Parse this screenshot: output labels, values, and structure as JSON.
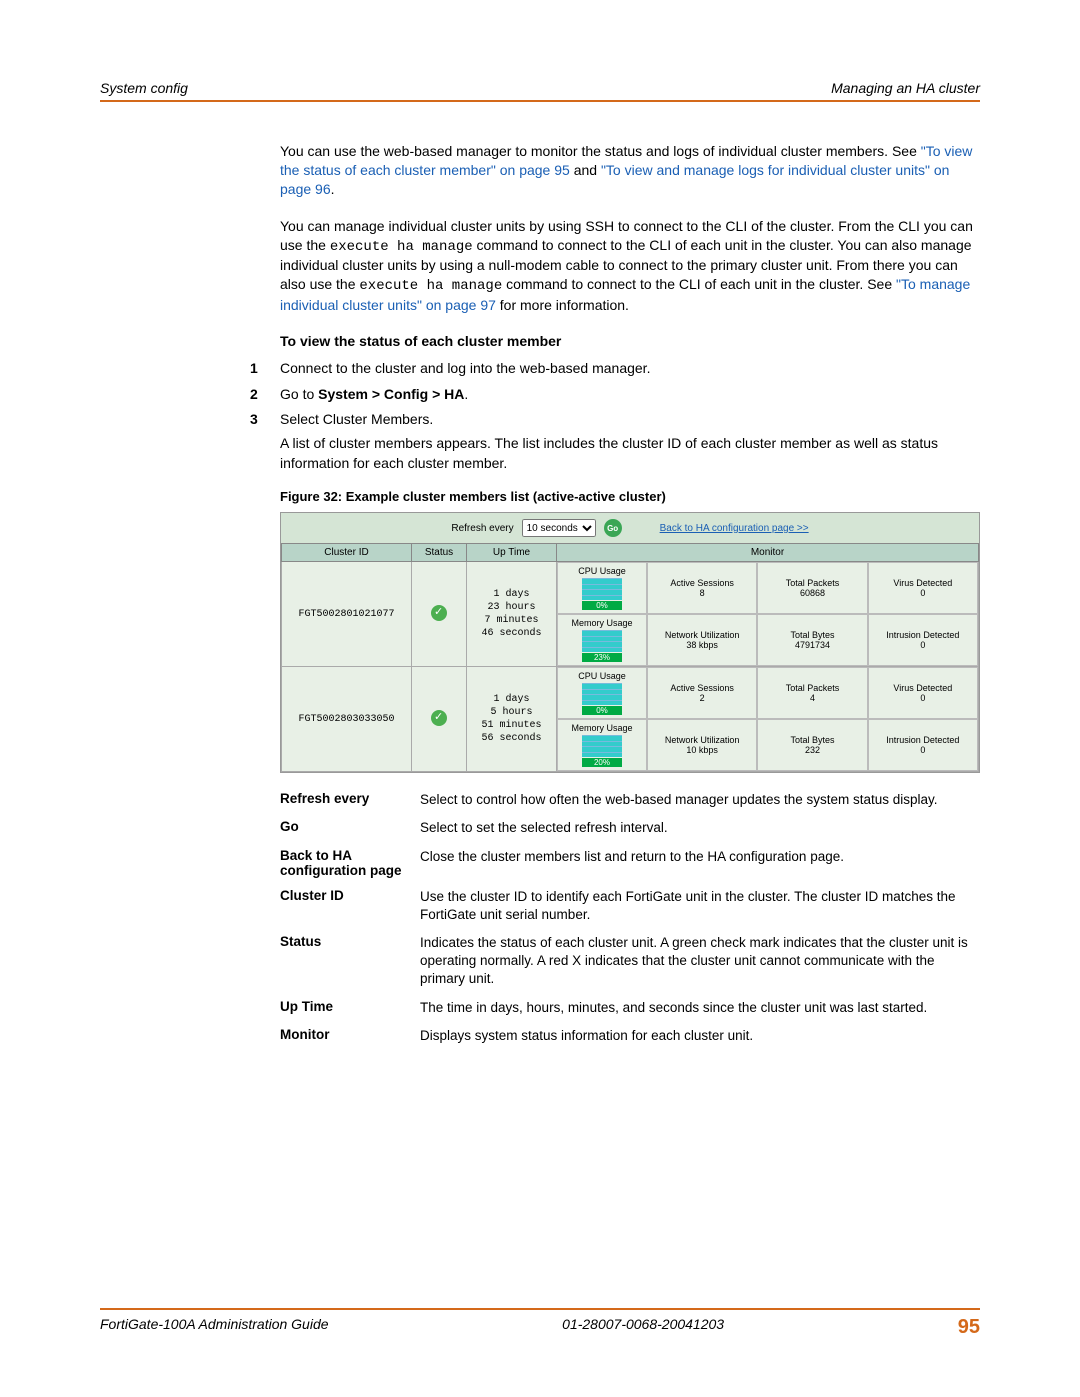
{
  "header": {
    "left": "System config",
    "right": "Managing an HA cluster"
  },
  "para1": {
    "t1": "You can use the web-based manager to monitor the status and logs of individual cluster members. See ",
    "l1": "\"To view the status of each cluster member\" on page 95",
    "t2": " and ",
    "l2": "\"To view and manage logs for individual cluster units\" on page 96",
    "t3": "."
  },
  "para2": {
    "t1": "You can manage individual cluster units by using SSH to connect to the CLI of the cluster. From the CLI you can use the ",
    "m1": "execute ha manage",
    "t2": " command to connect to the CLI of each unit in the cluster. You can also manage individual cluster units by using a null-modem cable to connect to the primary cluster unit. From there you can also use the ",
    "m2": "execute ha manage",
    "t3": " command to connect to the CLI of each unit in the cluster. See ",
    "l1": "\"To manage individual cluster units\" on page 97",
    "t4": " for more information."
  },
  "sectionHeading": "To view the status of each cluster member",
  "steps": [
    {
      "num": "1",
      "text": "Connect to the cluster and log into the web-based manager.",
      "boldPart": ""
    },
    {
      "num": "2",
      "text": "Go to ",
      "boldPart": "System > Config > HA",
      "after": "."
    },
    {
      "num": "3",
      "text": "Select Cluster Members.",
      "boldPart": ""
    }
  ],
  "step3extra": "A list of cluster members appears. The list includes the cluster ID of each cluster member as well as status information for each cluster member.",
  "figureCaption": "Figure 32: Example cluster members list (active-active cluster)",
  "screenshot": {
    "refreshLabel": "Refresh every",
    "refreshValue": "10 seconds",
    "goLabel": "Go",
    "backLink": "Back to HA configuration page >>",
    "columns": {
      "c1": "Cluster ID",
      "c2": "Status",
      "c3": "Up Time",
      "c4": "Monitor"
    },
    "rows": [
      {
        "clusterId": "FGT5002801021077",
        "uptime": "1 days\n23 hours\n7 minutes\n46 seconds",
        "cpuLabel": "CPU Usage",
        "cpuPct": "0%",
        "memLabel": "Memory Usage",
        "memPct": "23%",
        "activeSessionsLabel": "Active Sessions",
        "activeSessions": "8",
        "totalPacketsLabel": "Total Packets",
        "totalPackets": "60868",
        "virusLabel": "Virus Detected",
        "virus": "0",
        "netUtilLabel": "Network Utilization",
        "netUtil": "38 kbps",
        "totalBytesLabel": "Total Bytes",
        "totalBytes": "4791734",
        "intrusionLabel": "Intrusion Detected",
        "intrusion": "0"
      },
      {
        "clusterId": "FGT5002803033050",
        "uptime": "1 days\n5 hours\n51 minutes\n56 seconds",
        "cpuLabel": "CPU Usage",
        "cpuPct": "0%",
        "memLabel": "Memory Usage",
        "memPct": "20%",
        "activeSessionsLabel": "Active Sessions",
        "activeSessions": "2",
        "totalPacketsLabel": "Total Packets",
        "totalPackets": "4",
        "virusLabel": "Virus Detected",
        "virus": "0",
        "netUtilLabel": "Network Utilization",
        "netUtil": "10 kbps",
        "totalBytesLabel": "Total Bytes",
        "totalBytes": "232",
        "intrusionLabel": "Intrusion Detected",
        "intrusion": "0"
      }
    ]
  },
  "defs": [
    {
      "term": "Refresh every",
      "desc": "Select to control how often the web-based manager updates the system status display."
    },
    {
      "term": "Go",
      "desc": "Select to set the selected refresh interval."
    },
    {
      "term": "Back to HA configuration page",
      "desc": "Close the cluster members list and return to the HA configuration page."
    },
    {
      "term": "Cluster ID",
      "desc": "Use the cluster ID to identify each FortiGate unit in the cluster. The cluster ID matches the FortiGate unit serial number."
    },
    {
      "term": "Status",
      "desc": "Indicates the status of each cluster unit. A green check mark indicates that the cluster unit is operating normally. A red X indicates that the cluster unit cannot communicate with the primary unit."
    },
    {
      "term": "Up Time",
      "desc": "The time in days, hours, minutes, and seconds since the cluster unit was last started."
    },
    {
      "term": "Monitor",
      "desc": "Displays system status information for each cluster unit."
    }
  ],
  "footer": {
    "left": "FortiGate-100A Administration Guide",
    "center": "01-28007-0068-20041203",
    "page": "95"
  }
}
